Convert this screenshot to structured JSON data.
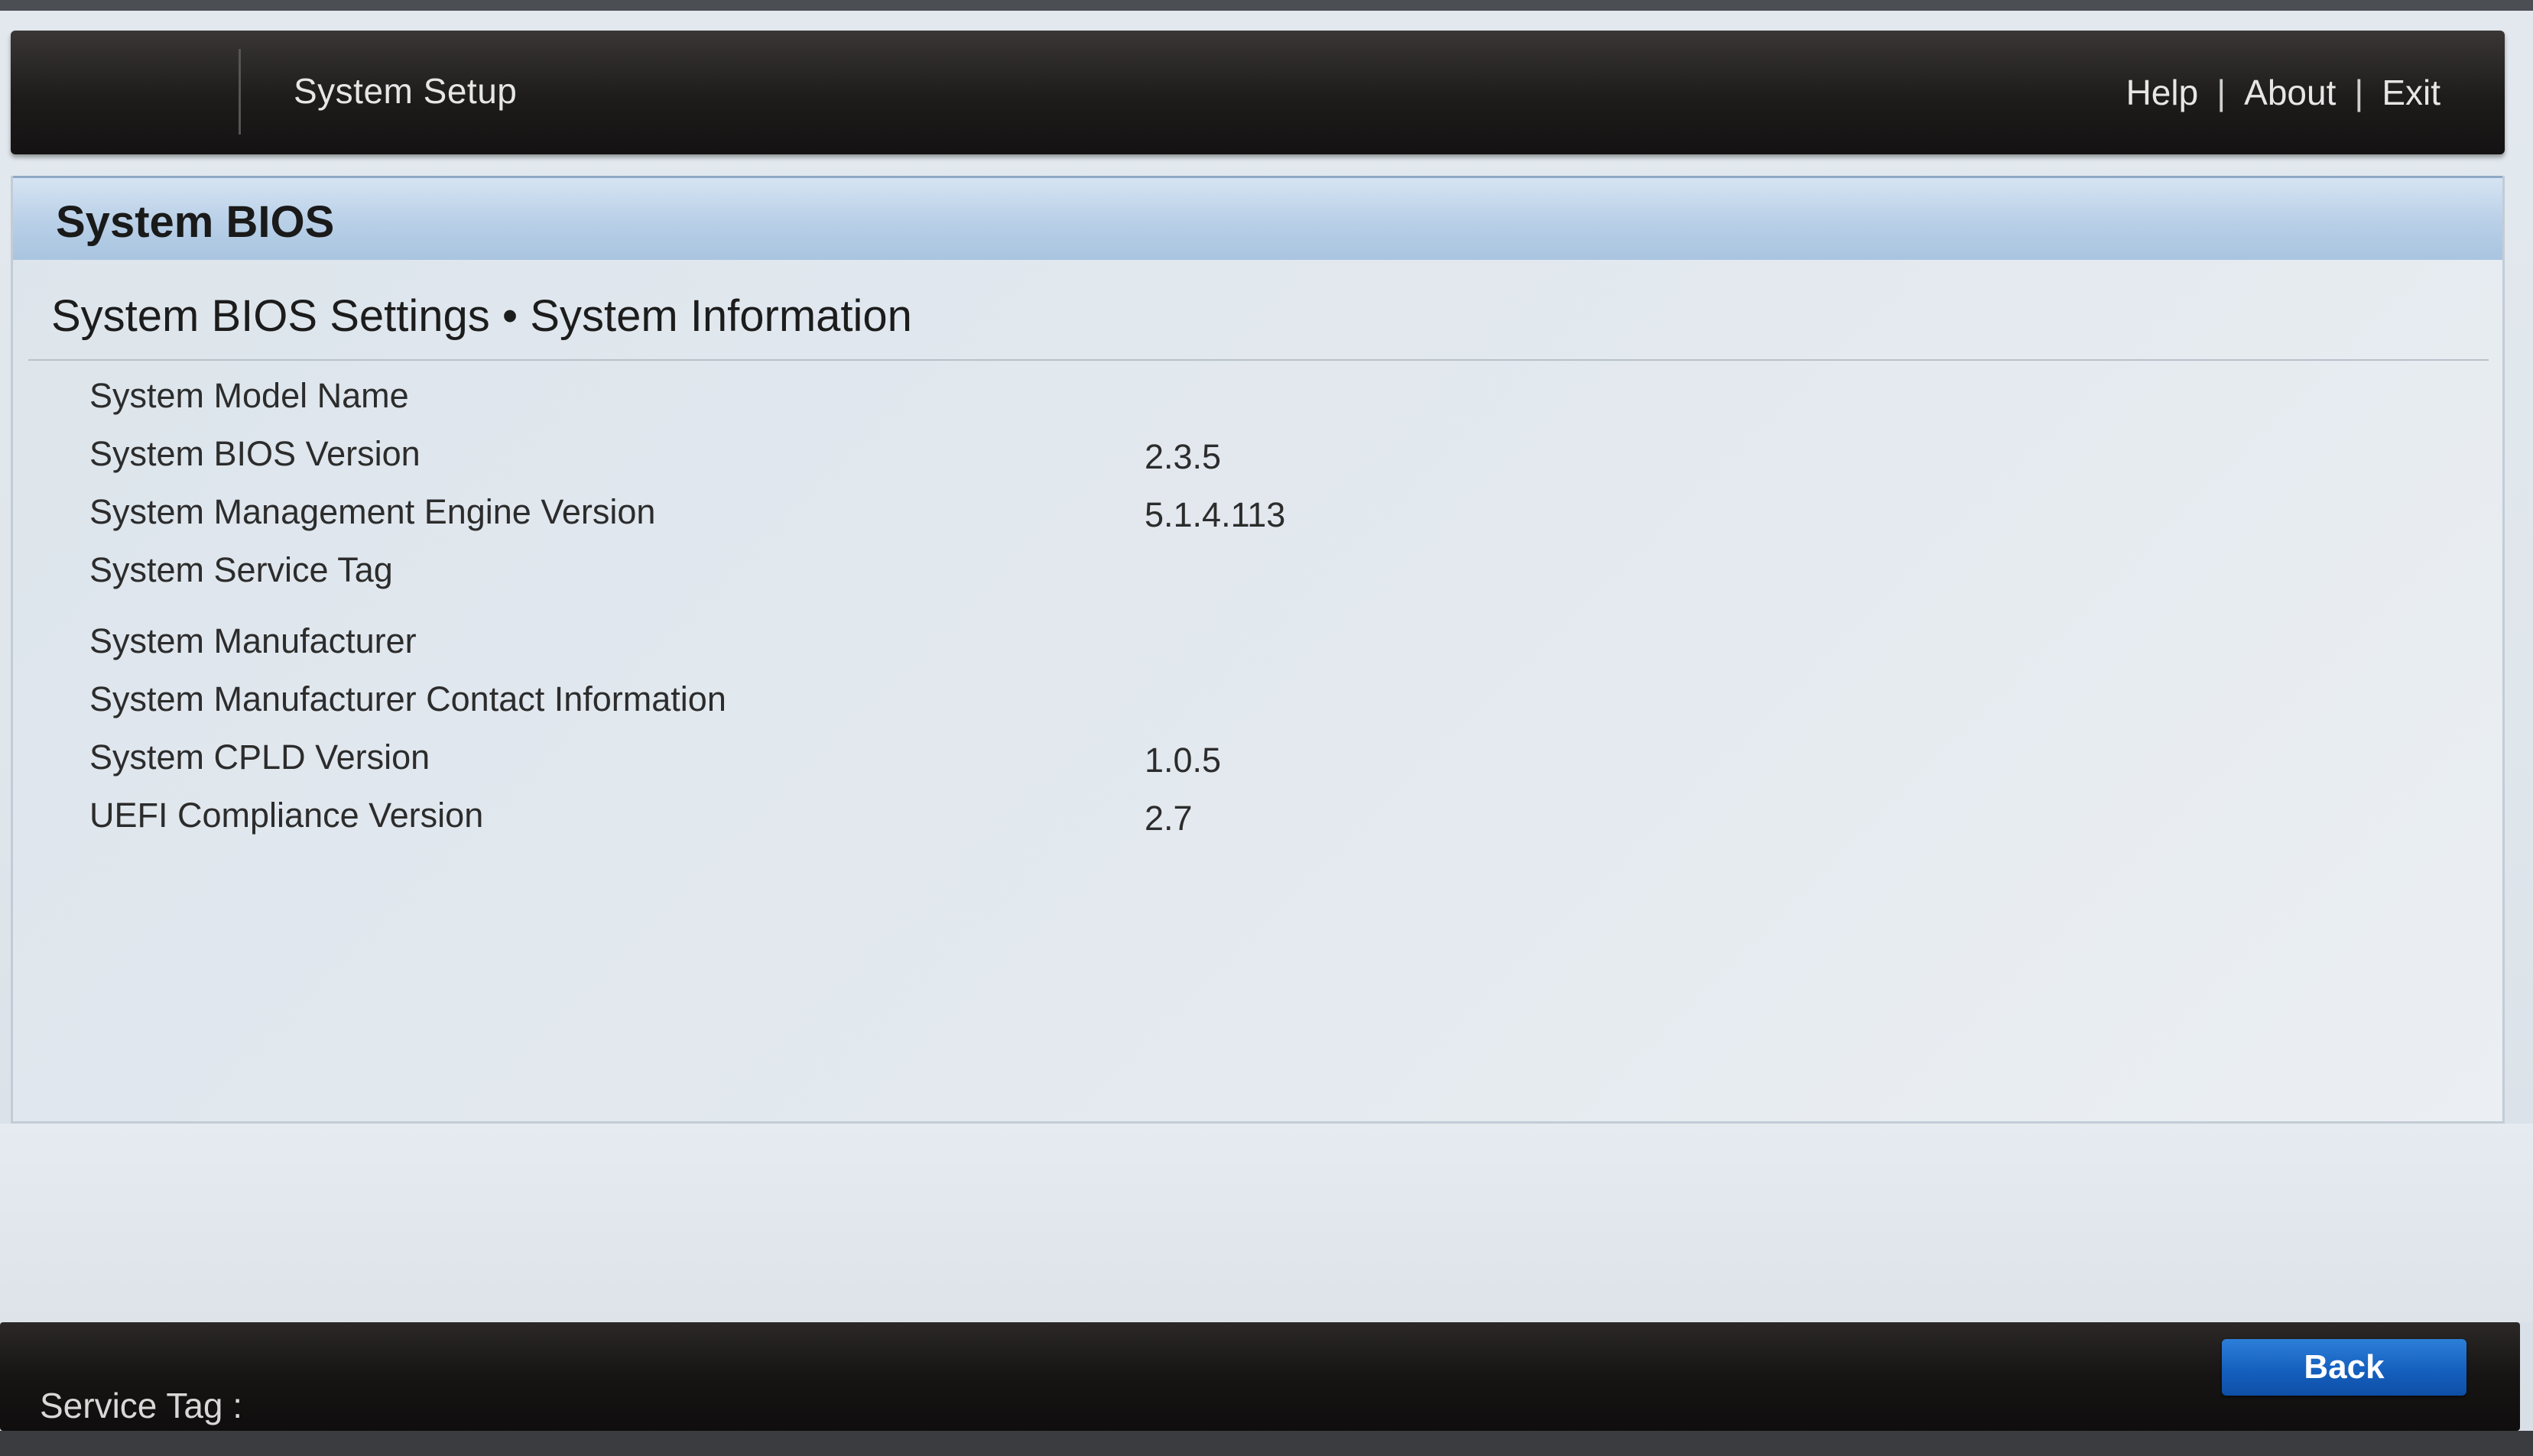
{
  "header": {
    "app_title": "System Setup",
    "links": [
      "Help",
      "About",
      "Exit"
    ],
    "separator": "|"
  },
  "panel": {
    "title": "System BIOS",
    "section_title": "System BIOS Settings • System Information",
    "rows": [
      {
        "label": "System Model Name",
        "value": ""
      },
      {
        "label": "System BIOS Version",
        "value": "2.3.5"
      },
      {
        "label": "System Management Engine Version",
        "value": "5.1.4.113"
      },
      {
        "label": "System Service Tag",
        "value": ""
      },
      {
        "label": "System Manufacturer",
        "value": ""
      },
      {
        "label": "System Manufacturer Contact Information",
        "value": ""
      },
      {
        "label": "System CPLD Version",
        "value": "1.0.5"
      },
      {
        "label": "UEFI Compliance Version",
        "value": "2.7"
      }
    ]
  },
  "footer": {
    "service_tag_label": "Service Tag :",
    "back_label": "Back"
  },
  "colors": {
    "accent_button": "#1560bf",
    "header_bg": "#1e1b1b",
    "panel_header_bg": "#b8cfe7"
  }
}
